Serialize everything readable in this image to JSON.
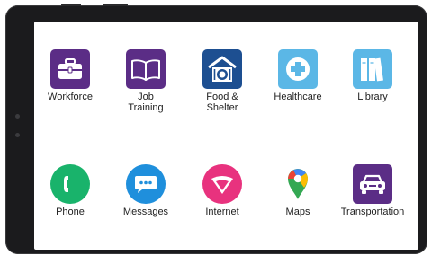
{
  "home_screen": {
    "apps_row1": [
      {
        "label": "Workforce",
        "icon": "briefcase-icon",
        "color": "#5b2d86"
      },
      {
        "label": "Job\nTraining",
        "icon": "book-icon",
        "color": "#5b2d86"
      },
      {
        "label": "Food &\nShelter",
        "icon": "house-dish-icon",
        "color": "#1d4f91"
      },
      {
        "label": "Healthcare",
        "icon": "medical-cross-icon",
        "color": "#5bb7e6"
      },
      {
        "label": "Library",
        "icon": "books-icon",
        "color": "#5bb7e6"
      }
    ],
    "apps_row2": [
      {
        "label": "Phone",
        "icon": "phone-icon",
        "color": "#19b36b"
      },
      {
        "label": "Messages",
        "icon": "chat-bubble-icon",
        "color": "#1f8fdc"
      },
      {
        "label": "Internet",
        "icon": "globe-icon",
        "color": "#e8327e"
      },
      {
        "label": "Maps",
        "icon": "map-pin-icon",
        "color": "#4285f4"
      },
      {
        "label": "Transportation",
        "icon": "car-icon",
        "color": "#5b2d86"
      }
    ]
  }
}
